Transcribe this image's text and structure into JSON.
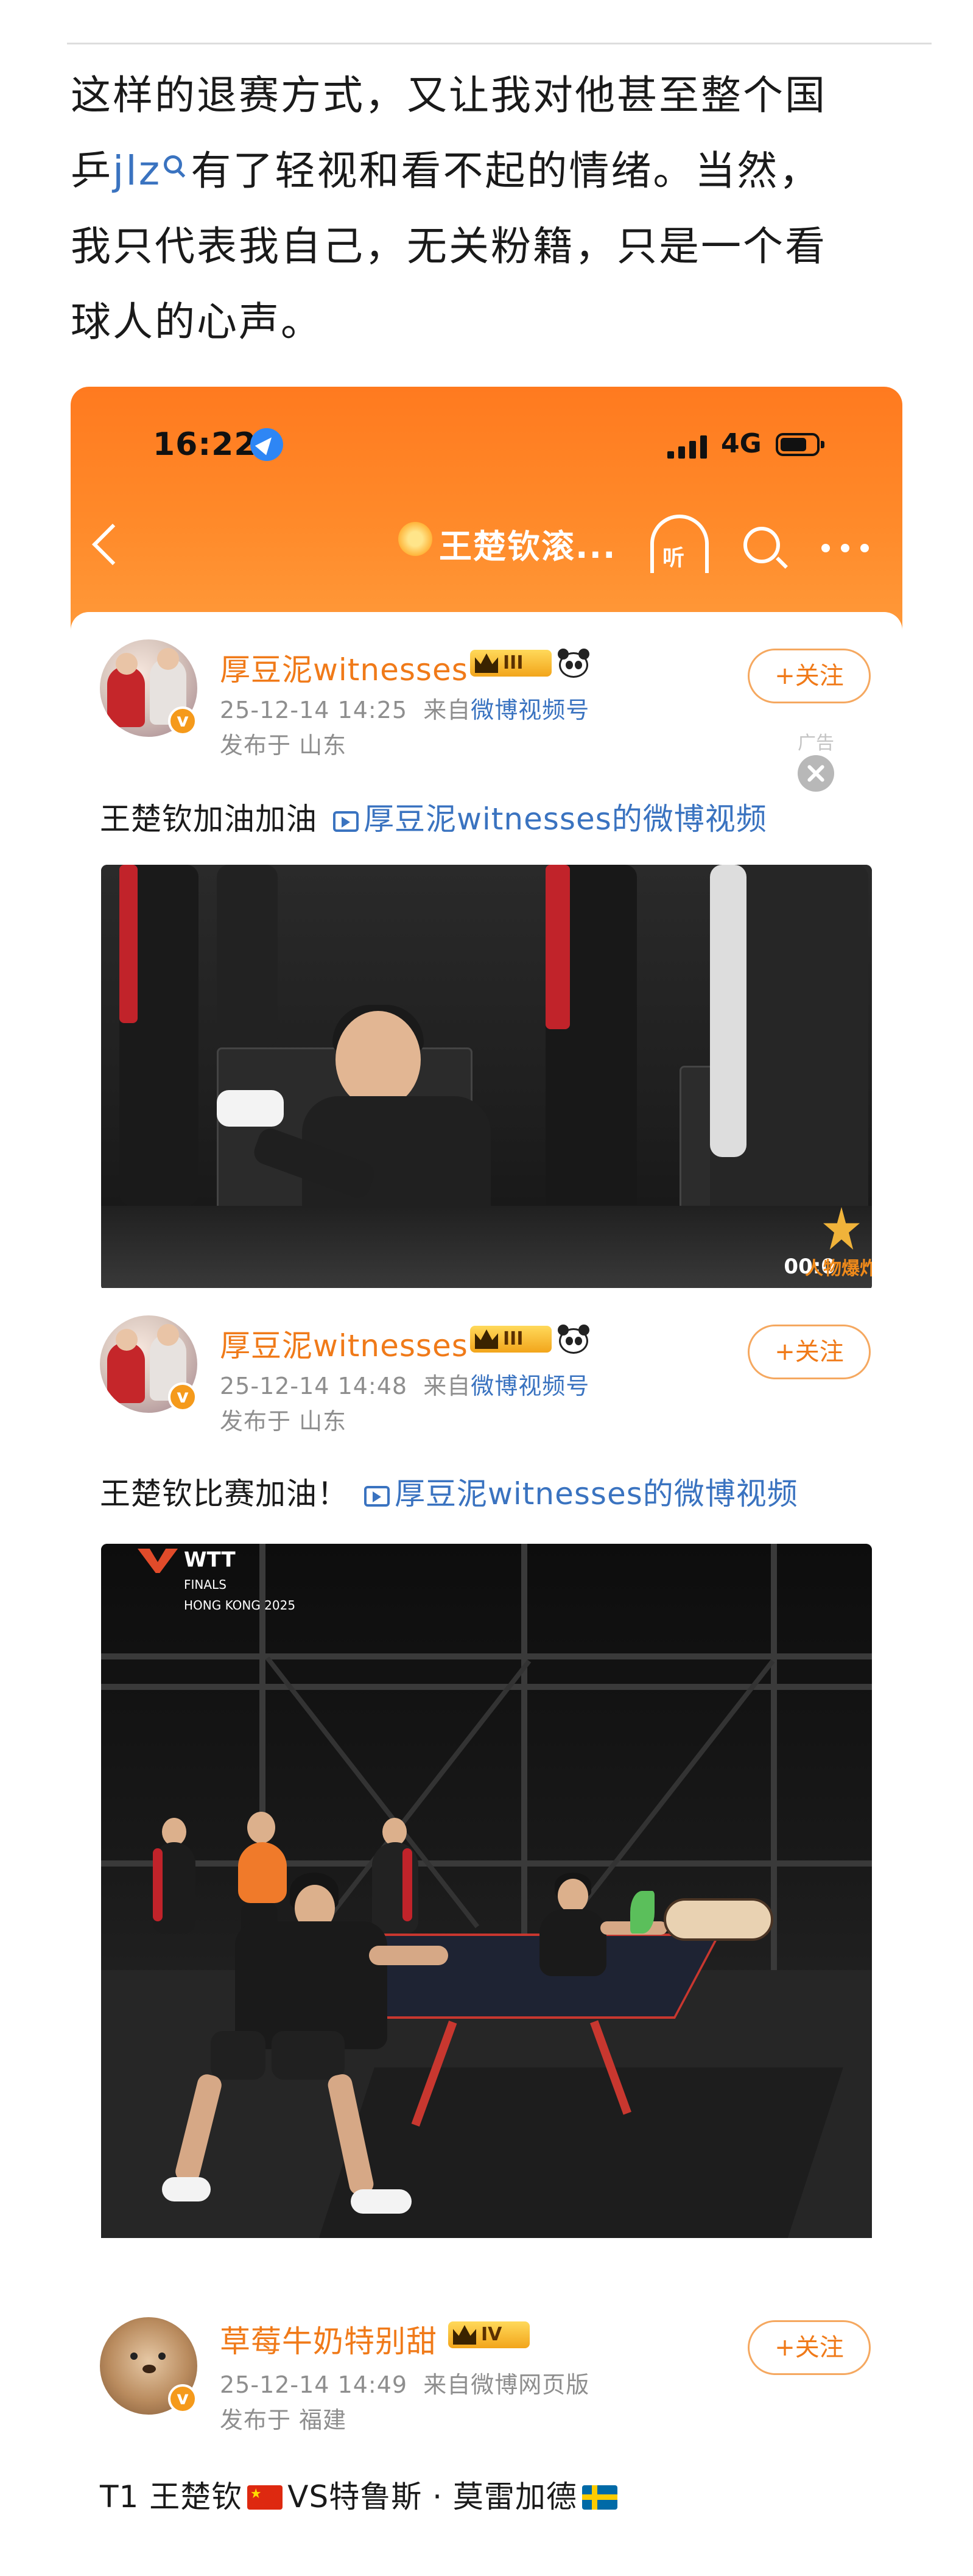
{
  "article": {
    "line1": "这样的退赛方式，又让我对他甚至整个国",
    "line2_pre": "乒",
    "topic_link": "jlz",
    "line2_post": "有了轻视和看不起的情绪。当然，",
    "line3": "我只代表我自己，无关粉籍，只是一个看",
    "line4": "球人的心声。"
  },
  "status_bar": {
    "time": "16:22",
    "network": "4G"
  },
  "nav": {
    "title": "王楚钦滚...",
    "listen_label": "听"
  },
  "posts": [
    {
      "username": "厚豆泥witnesses",
      "rank": "III",
      "verified": "v",
      "datetime": "25-12-14 14:25",
      "source_prefix": "来自",
      "source": "微博视频号",
      "location": "发布于 山东",
      "follow": "+关注",
      "text": "王楚钦加油加油",
      "video_link": "厚豆泥witnesses的微博视频",
      "video_time": "00:0",
      "watermark": "人物爆炸"
    },
    {
      "username": "厚豆泥witnesses",
      "rank": "III",
      "verified": "v",
      "datetime": "25-12-14 14:48",
      "source_prefix": "来自",
      "source": "微博视频号",
      "location": "发布于 山东",
      "follow": "+关注",
      "text": "王楚钦比赛加油！",
      "video_link": "厚豆泥witnesses的微博视频",
      "logo_main": "WTT",
      "logo_sub1": "FINALS",
      "logo_sub2": "HONG KONG 2025"
    },
    {
      "username": "草莓牛奶特别甜",
      "rank": "IV",
      "verified": "v",
      "datetime": "25-12-14 14:49",
      "source_prefix": "来自",
      "source": "微博网页版",
      "location": "发布于 福建",
      "follow": "+关注",
      "text_pre": "T1 王楚钦",
      "text_mid": "VS特鲁斯 · 莫雷加德"
    }
  ],
  "ad": {
    "label": "广告"
  },
  "colors": {
    "header_orange": "#ff7a1f",
    "username_orange": "#f07a19",
    "link_blue": "#3a73c0"
  },
  "icons": [
    "location-arrow-icon",
    "signal-icon",
    "battery-icon",
    "back-chevron-icon",
    "listen-icon",
    "search-icon",
    "more-icon",
    "crown-icon",
    "panda-icon",
    "video-link-icon",
    "close-icon"
  ]
}
